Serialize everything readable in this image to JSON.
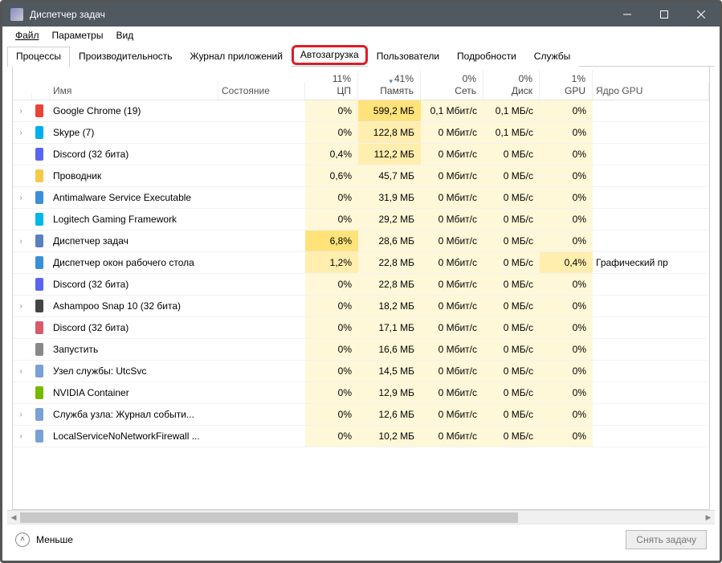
{
  "window": {
    "title": "Диспетчер задач"
  },
  "menu": {
    "file": "Файл",
    "options": "Параметры",
    "view": "Вид"
  },
  "tabs": {
    "processes": "Процессы",
    "performance": "Производительность",
    "app_history": "Журнал приложений",
    "startup": "Автозагрузка",
    "users": "Пользователи",
    "details": "Подробности",
    "services": "Службы"
  },
  "columns": {
    "name": "Имя",
    "state": "Состояние",
    "cpu_pct": "11%",
    "cpu": "ЦП",
    "mem_pct": "41%",
    "mem": "Память",
    "net_pct": "0%",
    "net": "Сеть",
    "disk_pct": "0%",
    "disk": "Диск",
    "gpu_pct": "1%",
    "gpu": "GPU",
    "gpu_engine": "Ядро GPU"
  },
  "rows": [
    {
      "exp": true,
      "icon": "chrome",
      "name": "Google Chrome (19)",
      "cpu": "0%",
      "mem": "599,2 МБ",
      "net": "0,1 Мбит/с",
      "disk": "0,1 МБ/с",
      "gpu": "0%",
      "gpuengine": ""
    },
    {
      "exp": true,
      "icon": "skype",
      "name": "Skype (7)",
      "cpu": "0%",
      "mem": "122,8 МБ",
      "net": "0 Мбит/с",
      "disk": "0,1 МБ/с",
      "gpu": "0%",
      "gpuengine": ""
    },
    {
      "exp": false,
      "icon": "discord",
      "name": "Discord (32 бита)",
      "cpu": "0,4%",
      "mem": "112,2 МБ",
      "net": "0 Мбит/с",
      "disk": "0 МБ/с",
      "gpu": "0%",
      "gpuengine": ""
    },
    {
      "exp": false,
      "icon": "explorer",
      "name": "Проводник",
      "cpu": "0,6%",
      "mem": "45,7 МБ",
      "net": "0 Мбит/с",
      "disk": "0 МБ/с",
      "gpu": "0%",
      "gpuengine": ""
    },
    {
      "exp": true,
      "icon": "defender",
      "name": "Antimalware Service Executable",
      "cpu": "0%",
      "mem": "31,9 МБ",
      "net": "0 Мбит/с",
      "disk": "0 МБ/с",
      "gpu": "0%",
      "gpuengine": ""
    },
    {
      "exp": false,
      "icon": "logitech",
      "name": "Logitech Gaming Framework",
      "cpu": "0%",
      "mem": "29,2 МБ",
      "net": "0 Мбит/с",
      "disk": "0 МБ/с",
      "gpu": "0%",
      "gpuengine": ""
    },
    {
      "exp": true,
      "icon": "taskmgr",
      "name": "Диспетчер задач",
      "cpu": "6,8%",
      "mem": "28,6 МБ",
      "net": "0 Мбит/с",
      "disk": "0 МБ/с",
      "gpu": "0%",
      "gpuengine": ""
    },
    {
      "exp": false,
      "icon": "dwm",
      "name": "Диспетчер окон рабочего стола",
      "cpu": "1,2%",
      "mem": "22,8 МБ",
      "net": "0 Мбит/с",
      "disk": "0 МБ/с",
      "gpu": "0,4%",
      "gpuengine": "Графический пр"
    },
    {
      "exp": false,
      "icon": "discord",
      "name": "Discord (32 бита)",
      "cpu": "0%",
      "mem": "22,8 МБ",
      "net": "0 Мбит/с",
      "disk": "0 МБ/с",
      "gpu": "0%",
      "gpuengine": ""
    },
    {
      "exp": true,
      "icon": "ashampoo",
      "name": "Ashampoo Snap 10 (32 бита)",
      "cpu": "0%",
      "mem": "18,2 МБ",
      "net": "0 Мбит/с",
      "disk": "0 МБ/с",
      "gpu": "0%",
      "gpuengine": ""
    },
    {
      "exp": false,
      "icon": "discord2",
      "name": "Discord (32 бита)",
      "cpu": "0%",
      "mem": "17,1 МБ",
      "net": "0 Мбит/с",
      "disk": "0 МБ/с",
      "gpu": "0%",
      "gpuengine": ""
    },
    {
      "exp": false,
      "icon": "launch",
      "name": "Запустить",
      "cpu": "0%",
      "mem": "16,6 МБ",
      "net": "0 Мбит/с",
      "disk": "0 МБ/с",
      "gpu": "0%",
      "gpuengine": ""
    },
    {
      "exp": true,
      "icon": "svchost",
      "name": "Узел службы: UtcSvc",
      "cpu": "0%",
      "mem": "14,5 МБ",
      "net": "0 Мбит/с",
      "disk": "0 МБ/с",
      "gpu": "0%",
      "gpuengine": ""
    },
    {
      "exp": false,
      "icon": "nvidia",
      "name": "NVIDIA Container",
      "cpu": "0%",
      "mem": "12,9 МБ",
      "net": "0 Мбит/с",
      "disk": "0 МБ/с",
      "gpu": "0%",
      "gpuengine": ""
    },
    {
      "exp": true,
      "icon": "svchost",
      "name": "Служба узла: Журнал событи...",
      "cpu": "0%",
      "mem": "12,6 МБ",
      "net": "0 Мбит/с",
      "disk": "0 МБ/с",
      "gpu": "0%",
      "gpuengine": ""
    },
    {
      "exp": true,
      "icon": "svchost",
      "name": "LocalServiceNoNetworkFirewall ...",
      "cpu": "0%",
      "mem": "10,2 МБ",
      "net": "0 Мбит/с",
      "disk": "0 МБ/с",
      "gpu": "0%",
      "gpuengine": ""
    }
  ],
  "footer": {
    "fewer": "Меньше",
    "end_task": "Снять задачу"
  },
  "heat": {
    "cpu": [
      "l",
      "l",
      "l",
      "l",
      "l",
      "l",
      "h",
      "m",
      "l",
      "l",
      "l",
      "l",
      "l",
      "l",
      "l",
      "l"
    ],
    "mem": [
      "h",
      "m",
      "m",
      "l",
      "l",
      "l",
      "l",
      "l",
      "l",
      "l",
      "l",
      "l",
      "l",
      "l",
      "l",
      "l"
    ],
    "net": [
      "l",
      "l",
      "l",
      "l",
      "l",
      "l",
      "l",
      "l",
      "l",
      "l",
      "l",
      "l",
      "l",
      "l",
      "l",
      "l"
    ],
    "disk": [
      "l",
      "l",
      "l",
      "l",
      "l",
      "l",
      "l",
      "l",
      "l",
      "l",
      "l",
      "l",
      "l",
      "l",
      "l",
      "l"
    ],
    "gpu": [
      "l",
      "l",
      "l",
      "l",
      "l",
      "l",
      "l",
      "m",
      "l",
      "l",
      "l",
      "l",
      "l",
      "l",
      "l",
      "l"
    ]
  },
  "icon_colors": {
    "chrome": "#ea4335",
    "skype": "#00aff0",
    "discord": "#5865f2",
    "explorer": "#f7c94b",
    "defender": "#3a8fd8",
    "logitech": "#00b8e6",
    "taskmgr": "#5a7fbf",
    "dwm": "#3a8fd8",
    "ashampoo": "#444",
    "discord2": "#d85a6a",
    "launch": "#888",
    "svchost": "#7aa0d8",
    "nvidia": "#76b900"
  }
}
